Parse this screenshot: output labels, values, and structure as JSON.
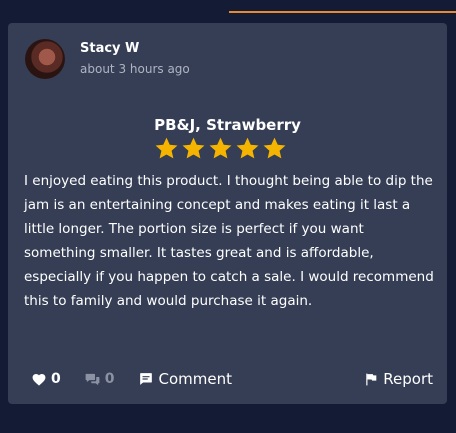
{
  "review": {
    "author": "Stacy W",
    "timestamp": "about 3 hours ago",
    "product_title": "PB&J, Strawberry",
    "rating": 5,
    "rating_max": 5,
    "text": "I enjoyed eating this product. I thought being able to dip the jam is an entertaining concept and makes eating it last a little longer. The portion size is perfect if you want something smaller. It tastes great and is affordable, especially if you happen to catch a sale. I would recommend this to family and would purchase it again."
  },
  "actions": {
    "likes_count": "0",
    "comments_count": "0",
    "comment_label": "Comment",
    "report_label": "Report"
  },
  "icons": {
    "like": "heart-icon",
    "replies": "speech-bubbles-icon",
    "comment": "comment-icon",
    "report": "flag-icon",
    "star": "star-icon"
  },
  "colors": {
    "background": "#141b34",
    "card": "#353e55",
    "accent": "#e88a2f",
    "star": "#f5b400",
    "muted": "#8b92a4"
  }
}
